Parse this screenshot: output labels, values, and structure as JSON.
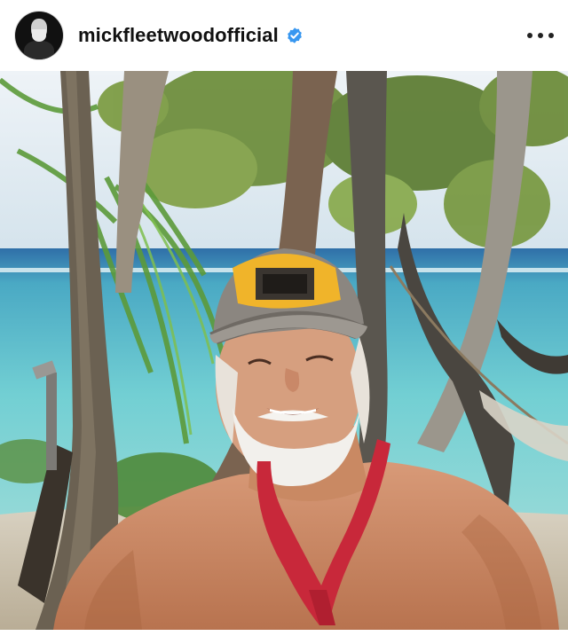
{
  "post": {
    "username": "mickfleetwoodofficial",
    "verified": true,
    "avatar_icon": "profile-avatar",
    "more_icon": "more-options-icon",
    "image_subject": "man-with-cap-on-beach"
  },
  "colors": {
    "verified_blue": "#3897f0",
    "sea": "#5fc4cd",
    "sky": "#dde8ef",
    "cap_yellow": "#f0b42a"
  }
}
